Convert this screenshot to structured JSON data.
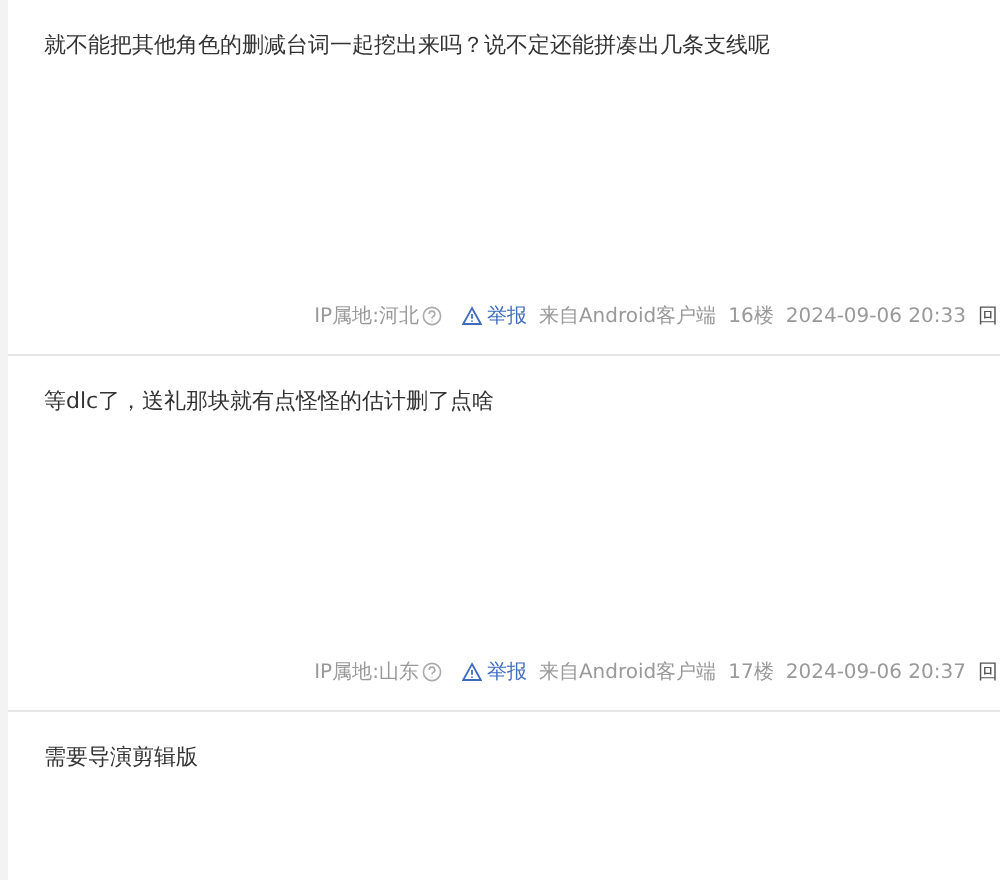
{
  "posts": [
    {
      "content": "就不能把其他角色的删减台词一起挖出来吗？说不定还能拼凑出几条支线呢",
      "ip_location": "IP属地:河北",
      "report": "举报",
      "source": "来自Android客户端",
      "floor": "16楼",
      "time": "2024-09-06 20:33",
      "reply": "回"
    },
    {
      "content": "等dlc了，送礼那块就有点怪怪的估计删了点啥",
      "ip_location": "IP属地:山东",
      "report": "举报",
      "source": "来自Android客户端",
      "floor": "17楼",
      "time": "2024-09-06 20:37",
      "reply": "回"
    },
    {
      "content": "需要导演剪辑版"
    }
  ]
}
